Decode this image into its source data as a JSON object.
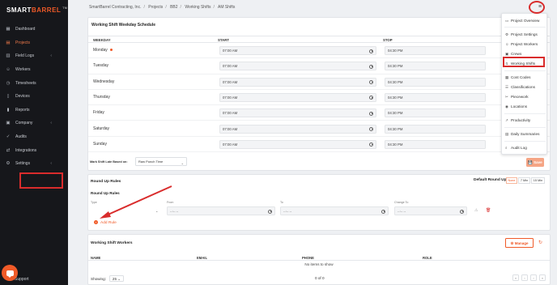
{
  "brand": {
    "name_part1": "SMART",
    "name_part2": "BARREL",
    "tm": "TM"
  },
  "sidebar": {
    "items": [
      {
        "label": "Dashboard",
        "icon": "dashboard-icon",
        "glyph": "▦"
      },
      {
        "label": "Projects",
        "icon": "folder-icon",
        "glyph": "▤",
        "active": true
      },
      {
        "label": "Field Logs",
        "icon": "book-icon",
        "glyph": "▥",
        "chevron": true
      },
      {
        "label": "Workers",
        "icon": "user-icon",
        "glyph": "☺"
      },
      {
        "label": "Timesheets",
        "icon": "clock-icon",
        "glyph": "◷"
      },
      {
        "label": "Devices",
        "icon": "device-icon",
        "glyph": "▯"
      },
      {
        "label": "Reports",
        "icon": "chart-icon",
        "glyph": "▮"
      },
      {
        "label": "Company",
        "icon": "building-icon",
        "glyph": "▣",
        "chevron": true
      },
      {
        "label": "Audits",
        "icon": "audit-icon",
        "glyph": "✓"
      },
      {
        "label": "Integrations",
        "icon": "plug-icon",
        "glyph": "⇄"
      },
      {
        "label": "Settings",
        "icon": "gear-icon",
        "glyph": "⚙",
        "chevron": true
      }
    ],
    "support_label": "Support"
  },
  "breadcrumb": [
    "SmartBarrel Contracting, Inc.",
    "Projects",
    "BB2",
    "Working Shifts",
    "AM Shifts"
  ],
  "schedule": {
    "title": "Working Shift Weekday Schedule",
    "headers": {
      "weekday": "WEEKDAY",
      "start": "START",
      "stop": "STOP"
    },
    "rows": [
      {
        "day": "Monday",
        "start": "07:00 AM",
        "stop": "04:30 PM"
      },
      {
        "day": "Tuesday",
        "start": "07:00 AM",
        "stop": "04:30 PM"
      },
      {
        "day": "Wednesday",
        "start": "07:00 AM",
        "stop": "04:30 PM"
      },
      {
        "day": "Thursday",
        "start": "07:00 AM",
        "stop": "04:30 PM"
      },
      {
        "day": "Friday",
        "start": "07:00 AM",
        "stop": "04:30 PM"
      },
      {
        "day": "Saturday",
        "start": "07:00 AM",
        "stop": "04:30 PM"
      },
      {
        "day": "Sunday",
        "start": "07:00 AM",
        "stop": "04:30 PM"
      }
    ],
    "late_label": "Mark Shift Late Based on:",
    "late_value": "Raw Punch Time",
    "save_label": "Save"
  },
  "round_up": {
    "title": "Round Up Rules",
    "default_label": "Default Round Up:",
    "options": [
      "None",
      "7 Min",
      "15 Min"
    ],
    "subtitle": "Round Up Rules",
    "fields": {
      "type": "Type",
      "from": "From",
      "to": "To",
      "change_to": "Change To"
    },
    "placeholder": "--:-- --",
    "add_rule_label": "Add Rule"
  },
  "workers": {
    "title": "Working Shift Workers",
    "manage_label": "Manage",
    "headers": {
      "name": "NAME",
      "email": "EMAIL",
      "phone": "PHONE",
      "role": "ROLE"
    },
    "empty_message": "No items to show",
    "showing_label": "Showing:",
    "page_size": "25",
    "count": "0 of 0"
  },
  "menu": {
    "items": [
      {
        "label": "Project Overview",
        "glyph": "▭"
      },
      {
        "label": "Project Settings",
        "glyph": "⚙"
      },
      {
        "label": "Project Workers",
        "glyph": "☺"
      },
      {
        "label": "Crews",
        "glyph": "▣"
      },
      {
        "label": "Working Shifts",
        "glyph": "↯"
      },
      {
        "label": "Cost Codes",
        "glyph": "▦"
      },
      {
        "label": "Classifications",
        "glyph": "☰"
      },
      {
        "label": "Piecework",
        "glyph": "✂"
      },
      {
        "label": "Locations",
        "glyph": "◉"
      },
      {
        "label": "Productivity",
        "glyph": "↗"
      },
      {
        "label": "Daily Summaries",
        "glyph": "▤"
      },
      {
        "label": "Audit Log",
        "glyph": "⌕"
      }
    ]
  },
  "colors": {
    "accent": "#f05a28",
    "highlight": "#d92c2c",
    "sidebar": "#16171b"
  }
}
